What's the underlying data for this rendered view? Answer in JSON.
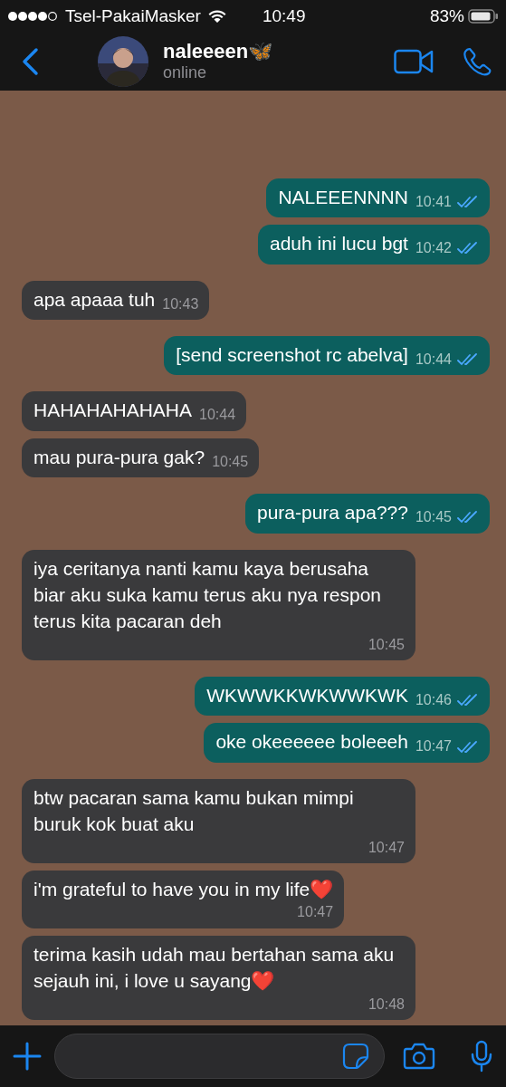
{
  "status_bar": {
    "carrier": "Tsel-PakaiMasker",
    "time": "10:49",
    "battery": "83%"
  },
  "header": {
    "contact": "naleeeen🦋",
    "presence": "online"
  },
  "messages": [
    {
      "kind": "out",
      "text": "NALEEENNNN",
      "time": "10:41",
      "read": true
    },
    {
      "kind": "out",
      "text": "aduh ini lucu bgt",
      "time": "10:42",
      "read": true
    },
    {
      "kind": "in",
      "text": "apa apaaa tuh",
      "time": "10:43"
    },
    {
      "kind": "out",
      "text": "[send screenshot rc abelva]",
      "time": "10:44",
      "read": true
    },
    {
      "kind": "in",
      "text": "HAHAHAHAHAHA",
      "time": "10:44"
    },
    {
      "kind": "in",
      "text": "mau pura-pura gak?",
      "time": "10:45"
    },
    {
      "kind": "out",
      "text": "pura-pura apa???",
      "time": "10:45",
      "read": true
    },
    {
      "kind": "in",
      "text": "iya ceritanya nanti kamu kaya berusaha biar aku suka kamu terus aku nya respon terus kita pacaran deh",
      "time": "10:45"
    },
    {
      "kind": "out",
      "text": "WKWWKKWKWWKWK",
      "time": "10:46",
      "read": true
    },
    {
      "kind": "out",
      "text": "oke okeeeeee boleeeh",
      "time": "10:47",
      "read": true
    },
    {
      "kind": "in",
      "text": "btw pacaran sama kamu bukan mimpi buruk kok buat aku",
      "time": "10:47"
    },
    {
      "kind": "in",
      "text": "i'm grateful to have you in my life❤️",
      "time": "10:47"
    },
    {
      "kind": "in",
      "text": "terima kasih udah mau bertahan sama aku sejauh ini, i love u sayang❤️",
      "time": "10:48"
    }
  ]
}
